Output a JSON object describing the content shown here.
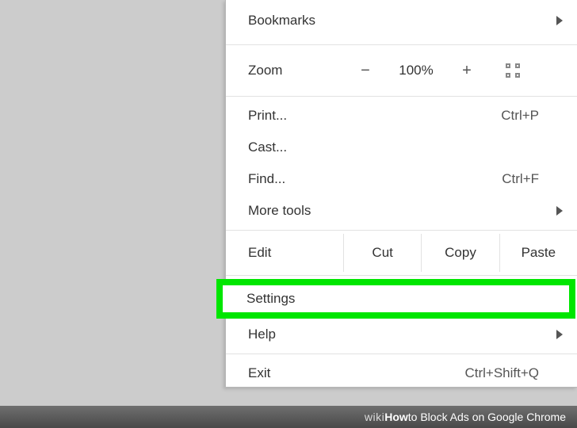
{
  "menu": {
    "bookmarks": "Bookmarks",
    "zoom_label": "Zoom",
    "zoom_minus": "−",
    "zoom_pct": "100%",
    "zoom_plus": "+",
    "print": "Print...",
    "print_shortcut": "Ctrl+P",
    "cast": "Cast...",
    "find": "Find...",
    "find_shortcut": "Ctrl+F",
    "more_tools": "More tools",
    "edit": "Edit",
    "cut": "Cut",
    "copy": "Copy",
    "paste": "Paste",
    "settings": "Settings",
    "help": "Help",
    "exit": "Exit",
    "exit_shortcut": "Ctrl+Shift+Q"
  },
  "watermark": {
    "wiki": "wiki",
    "how": "How",
    "title": " to Block Ads on Google Chrome"
  }
}
